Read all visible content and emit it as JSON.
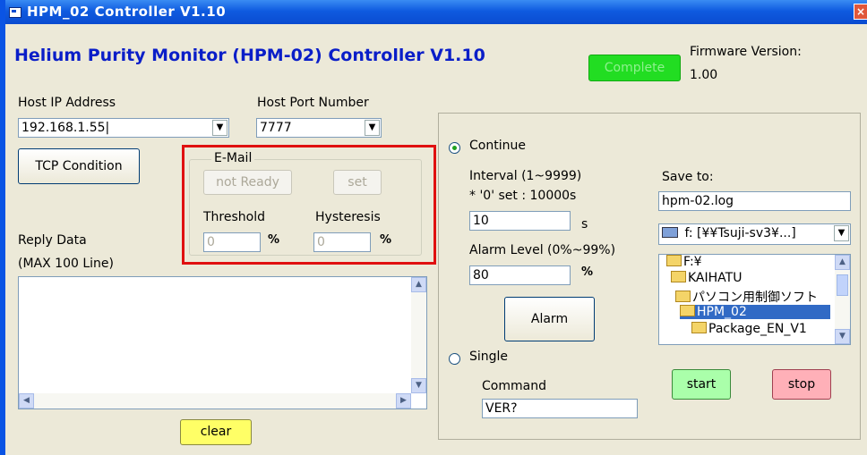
{
  "window": {
    "title": "HPM_02 Controller V1.10",
    "close_label": "×"
  },
  "header": {
    "app_title": "Helium Purity Monitor (HPM-02) Controller V1.10",
    "status_button": "Complete",
    "status_color": "#22dd22",
    "firmware_label": "Firmware Version:",
    "firmware_value": "1.00"
  },
  "connection": {
    "host_ip_label": "Host IP Address",
    "host_ip_value": "192.168.1.55|",
    "host_port_label": "Host Port Number",
    "host_port_value": "7777",
    "tcp_button": "TCP Condition"
  },
  "email": {
    "legend": "E-Mail",
    "not_ready_button": "not Ready",
    "set_button": "set",
    "threshold_label": "Threshold",
    "threshold_value": "0",
    "threshold_unit": "%",
    "hysteresis_label": "Hysteresis",
    "hysteresis_value": "0",
    "hysteresis_unit": "%",
    "highlight_color": "#e01010"
  },
  "reply": {
    "label_line1": "Reply Data",
    "label_line2": "(MAX 100 Line)",
    "clear_button": "clear"
  },
  "measure": {
    "continue_label": "Continue",
    "interval_label": "Interval (1~9999)",
    "interval_note": "* '0' set : 10000s",
    "interval_value": "10",
    "interval_unit": "s",
    "alarm_level_label": "Alarm Level (0%~99%)",
    "alarm_level_value": "80",
    "alarm_level_unit": "%",
    "alarm_button": "Alarm",
    "single_label": "Single",
    "command_label": "Command",
    "command_value": "VER?"
  },
  "save": {
    "save_to_label": "Save to:",
    "filename": "hpm-02.log",
    "drive": "f: [¥¥Tsuji-sv3¥...]",
    "folders": [
      "F:¥",
      "KAIHATU",
      "パソコン用制御ソフト",
      "HPM_02",
      "Package_EN_V1"
    ],
    "start_button": "start",
    "stop_button": "stop"
  }
}
